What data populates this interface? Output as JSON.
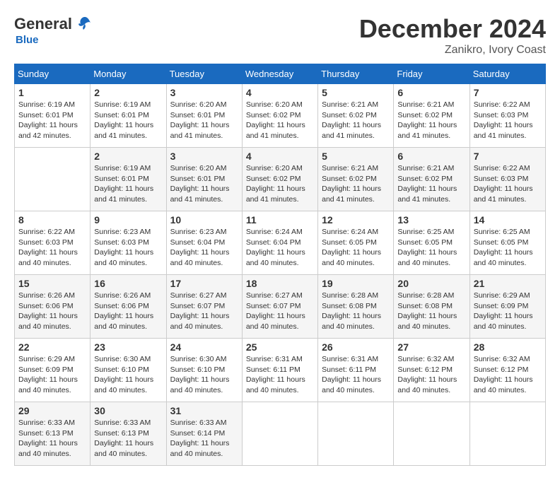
{
  "header": {
    "logo_general": "General",
    "logo_blue": "Blue",
    "month_title": "December 2024",
    "location": "Zanikro, Ivory Coast"
  },
  "calendar": {
    "days_of_week": [
      "Sunday",
      "Monday",
      "Tuesday",
      "Wednesday",
      "Thursday",
      "Friday",
      "Saturday"
    ],
    "weeks": [
      [
        {
          "day": "",
          "info": ""
        },
        {
          "day": "2",
          "info": "Sunrise: 6:19 AM\nSunset: 6:01 PM\nDaylight: 11 hours and 41 minutes."
        },
        {
          "day": "3",
          "info": "Sunrise: 6:20 AM\nSunset: 6:01 PM\nDaylight: 11 hours and 41 minutes."
        },
        {
          "day": "4",
          "info": "Sunrise: 6:20 AM\nSunset: 6:02 PM\nDaylight: 11 hours and 41 minutes."
        },
        {
          "day": "5",
          "info": "Sunrise: 6:21 AM\nSunset: 6:02 PM\nDaylight: 11 hours and 41 minutes."
        },
        {
          "day": "6",
          "info": "Sunrise: 6:21 AM\nSunset: 6:02 PM\nDaylight: 11 hours and 41 minutes."
        },
        {
          "day": "7",
          "info": "Sunrise: 6:22 AM\nSunset: 6:03 PM\nDaylight: 11 hours and 41 minutes."
        }
      ],
      [
        {
          "day": "8",
          "info": "Sunrise: 6:22 AM\nSunset: 6:03 PM\nDaylight: 11 hours and 40 minutes."
        },
        {
          "day": "9",
          "info": "Sunrise: 6:23 AM\nSunset: 6:03 PM\nDaylight: 11 hours and 40 minutes."
        },
        {
          "day": "10",
          "info": "Sunrise: 6:23 AM\nSunset: 6:04 PM\nDaylight: 11 hours and 40 minutes."
        },
        {
          "day": "11",
          "info": "Sunrise: 6:24 AM\nSunset: 6:04 PM\nDaylight: 11 hours and 40 minutes."
        },
        {
          "day": "12",
          "info": "Sunrise: 6:24 AM\nSunset: 6:05 PM\nDaylight: 11 hours and 40 minutes."
        },
        {
          "day": "13",
          "info": "Sunrise: 6:25 AM\nSunset: 6:05 PM\nDaylight: 11 hours and 40 minutes."
        },
        {
          "day": "14",
          "info": "Sunrise: 6:25 AM\nSunset: 6:05 PM\nDaylight: 11 hours and 40 minutes."
        }
      ],
      [
        {
          "day": "15",
          "info": "Sunrise: 6:26 AM\nSunset: 6:06 PM\nDaylight: 11 hours and 40 minutes."
        },
        {
          "day": "16",
          "info": "Sunrise: 6:26 AM\nSunset: 6:06 PM\nDaylight: 11 hours and 40 minutes."
        },
        {
          "day": "17",
          "info": "Sunrise: 6:27 AM\nSunset: 6:07 PM\nDaylight: 11 hours and 40 minutes."
        },
        {
          "day": "18",
          "info": "Sunrise: 6:27 AM\nSunset: 6:07 PM\nDaylight: 11 hours and 40 minutes."
        },
        {
          "day": "19",
          "info": "Sunrise: 6:28 AM\nSunset: 6:08 PM\nDaylight: 11 hours and 40 minutes."
        },
        {
          "day": "20",
          "info": "Sunrise: 6:28 AM\nSunset: 6:08 PM\nDaylight: 11 hours and 40 minutes."
        },
        {
          "day": "21",
          "info": "Sunrise: 6:29 AM\nSunset: 6:09 PM\nDaylight: 11 hours and 40 minutes."
        }
      ],
      [
        {
          "day": "22",
          "info": "Sunrise: 6:29 AM\nSunset: 6:09 PM\nDaylight: 11 hours and 40 minutes."
        },
        {
          "day": "23",
          "info": "Sunrise: 6:30 AM\nSunset: 6:10 PM\nDaylight: 11 hours and 40 minutes."
        },
        {
          "day": "24",
          "info": "Sunrise: 6:30 AM\nSunset: 6:10 PM\nDaylight: 11 hours and 40 minutes."
        },
        {
          "day": "25",
          "info": "Sunrise: 6:31 AM\nSunset: 6:11 PM\nDaylight: 11 hours and 40 minutes."
        },
        {
          "day": "26",
          "info": "Sunrise: 6:31 AM\nSunset: 6:11 PM\nDaylight: 11 hours and 40 minutes."
        },
        {
          "day": "27",
          "info": "Sunrise: 6:32 AM\nSunset: 6:12 PM\nDaylight: 11 hours and 40 minutes."
        },
        {
          "day": "28",
          "info": "Sunrise: 6:32 AM\nSunset: 6:12 PM\nDaylight: 11 hours and 40 minutes."
        }
      ],
      [
        {
          "day": "29",
          "info": "Sunrise: 6:33 AM\nSunset: 6:13 PM\nDaylight: 11 hours and 40 minutes."
        },
        {
          "day": "30",
          "info": "Sunrise: 6:33 AM\nSunset: 6:13 PM\nDaylight: 11 hours and 40 minutes."
        },
        {
          "day": "31",
          "info": "Sunrise: 6:33 AM\nSunset: 6:14 PM\nDaylight: 11 hours and 40 minutes."
        },
        {
          "day": "",
          "info": ""
        },
        {
          "day": "",
          "info": ""
        },
        {
          "day": "",
          "info": ""
        },
        {
          "day": "",
          "info": ""
        }
      ]
    ],
    "week0_day1": {
      "day": "1",
      "info": "Sunrise: 6:19 AM\nSunset: 6:01 PM\nDaylight: 11 hours and 42 minutes."
    }
  }
}
